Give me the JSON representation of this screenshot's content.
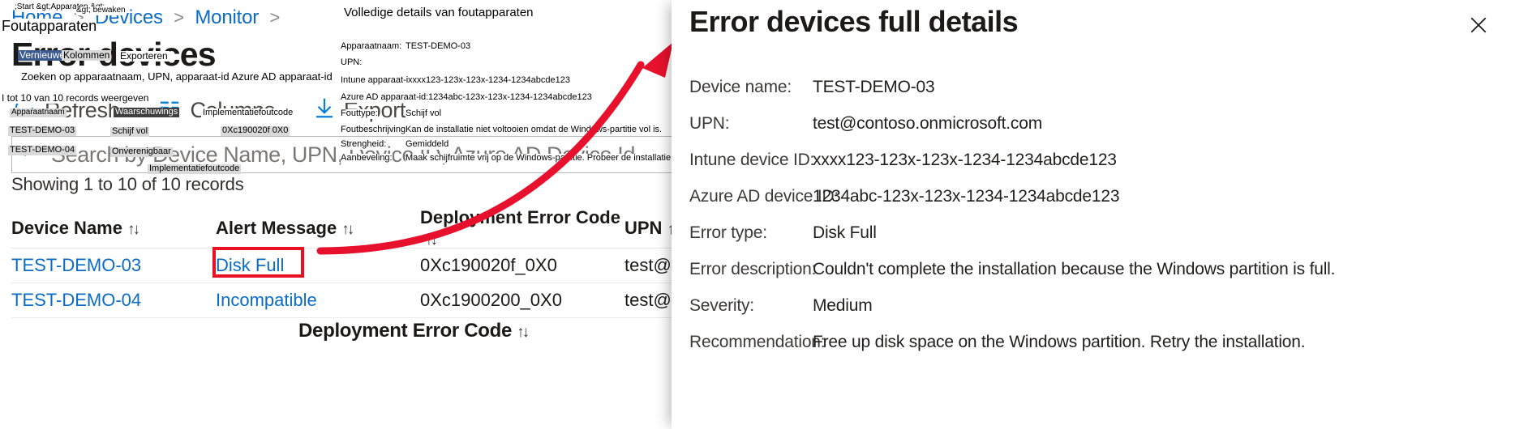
{
  "breadcrumb": {
    "items": [
      {
        "label": "Home"
      },
      {
        "label": "Devices"
      },
      {
        "label": "Monitor"
      }
    ],
    "separator": ">"
  },
  "page": {
    "title": "Error devices",
    "records_count": "Showing 1 to 10 of 10 records"
  },
  "toolbar": {
    "refresh_label": "Refresh",
    "columns_label": "Columns",
    "export_label": "Export"
  },
  "search": {
    "placeholder": "Search by Device Name, UPN, Device ID, Azure AD Device Id"
  },
  "table": {
    "columns": [
      {
        "label": "Device Name",
        "sort": "↑↓"
      },
      {
        "label": "Alert Message",
        "sort": "↑↓"
      },
      {
        "label": "Deployment Error Code",
        "sort": "↑↓"
      },
      {
        "label": "UPN",
        "sort": "↑"
      }
    ],
    "rows": [
      {
        "device_name": "TEST-DEMO-03",
        "alert_message": "Disk Full",
        "error_code": "0Xc190020f_0X0",
        "upn": "test@c"
      },
      {
        "device_name": "TEST-DEMO-04",
        "alert_message": "Incompatible",
        "error_code": "0Xc1900200_0X0",
        "upn": "test@c"
      }
    ],
    "footer_column": "Deployment Error Code",
    "footer_sort": "↑↓"
  },
  "overlay": {
    "breadcrumb_top": ";Start &gt;Apparaten &gt;",
    "breadcrumb_top2": "&gt; bewaken",
    "breadcrumb_bottom": "Foutapparaten",
    "title_caption": "Volledige details van foutapparaten",
    "refresh": "Vernieuwen",
    "columns": "Kolommen",
    "export": "Exporteren",
    "search_hint": "Zoeken op apparaatnaam, UPN, apparaat-id Azure AD apparaat-id",
    "records": "I tot 10 van 10 records weergeven",
    "col_device": "Apparaatnaam",
    "col_alert": "Waarschuwings",
    "col_code": "Implementatiefoutcode",
    "col_code2": "Implementatiefoutcode",
    "row1_device": "TEST-DEMO-03",
    "row1_alert": "Schijf vol",
    "row1_code": "0Xc190020f 0X0",
    "row2_device": "TEST-DEMO-04",
    "row2_alert": "Onverenigbaar",
    "detail_device_label": "Apparaatnaam:",
    "detail_device_value": "TEST-DEMO-03",
    "detail_upn_label": "UPN:",
    "detail_intune_label": "Intune apparaat-id:",
    "detail_intune_value": "xxxx123-123x-123x-1234-1234abcde123",
    "detail_aad_label": "Azure AD apparaat-id:",
    "detail_aad_value": "1234abc-123x-123x-1234-1234abcde123",
    "detail_errtype_label": "Fouttype:",
    "detail_errtype_value": "Schijf vol",
    "detail_errdesc_label": "Foutbeschrijving:",
    "detail_errdesc_value": "Kan de installatie niet voltooien omdat de Windows-partitie vol is.",
    "detail_sev_label": "Strengheid:",
    "detail_sev_value": "Gemiddeld",
    "detail_rec_label": "Aanbeveling:",
    "detail_rec_value": "Maak schijfruimte vrij op de Windows-partitie. Probeer de installatie opnieuw uit te voeren."
  },
  "flyout": {
    "title": "Error devices full details",
    "close_icon": "✕",
    "details": [
      {
        "label": "Device name:",
        "value": "TEST-DEMO-03"
      },
      {
        "label": "UPN:",
        "value": "test@contoso.onmicrosoft.com"
      },
      {
        "label": "Intune device ID:",
        "value": "xxxx123-123x-123x-1234-1234abcde123"
      },
      {
        "label": "Azure AD device ID:",
        "value": "1234abc-123x-123x-1234-1234abcde123"
      },
      {
        "label": "Error type:",
        "value": "Disk Full"
      },
      {
        "label": "Error description:",
        "value": "Couldn't complete the installation because the Windows partition is full."
      },
      {
        "label": "Severity:",
        "value": "Medium"
      },
      {
        "label": "Recommendation:",
        "value": "Free up disk space on the Windows partition. Retry the installation."
      }
    ]
  },
  "colors": {
    "link": "#0a6cc4",
    "accent": "#0078d4",
    "highlight": "#e81123",
    "arrow": "#e8112d"
  }
}
